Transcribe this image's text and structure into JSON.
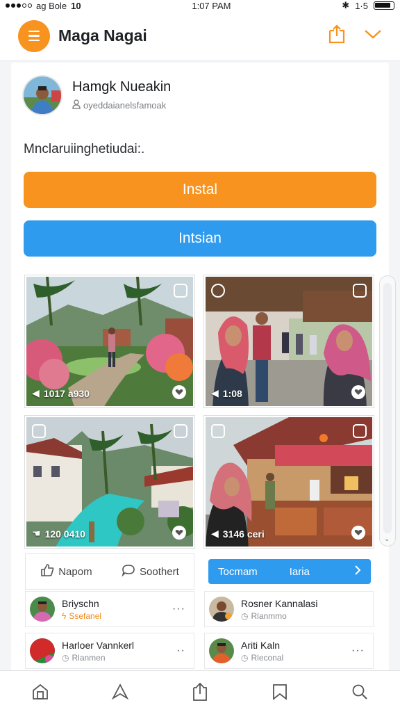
{
  "status": {
    "carrier": "ag Bole",
    "extra": "10",
    "time": "1:07 PAM",
    "battery_text": "1·5"
  },
  "header": {
    "title": "Maga Nagai"
  },
  "profile": {
    "name": "Hamgk Nueakin",
    "handle": "oyeddaianelsfamoak"
  },
  "description": "Mnclaruiinghetiudai:.",
  "buttons": {
    "install": "Instal",
    "secondary": "Intsian"
  },
  "photos": [
    {
      "caption": "1017 a930"
    },
    {
      "caption": "1:08"
    },
    {
      "caption": "120 0410"
    },
    {
      "caption": "3146 ceri"
    }
  ],
  "actions": {
    "like": "Napom",
    "comment": "Soothert"
  },
  "blue_bar": {
    "label1": "Tocmam",
    "label2": "Iaria"
  },
  "users": [
    {
      "name": "Briyschn",
      "sub": "Ssefanel",
      "more": "···",
      "orange": true
    },
    {
      "name": "Rosner Kannalasi",
      "sub": "Rlanmmo",
      "more": "",
      "orange": false
    },
    {
      "name": "Harloer Vannkerl",
      "sub": "Rlanmen",
      "more": "··",
      "orange": false
    },
    {
      "name": "Ariti Kaln",
      "sub": "Rleconal",
      "more": "···",
      "orange": false
    }
  ],
  "icons": {
    "menu": "menu-icon",
    "share": "share-icon",
    "chevron": "chevron-down-icon",
    "home": "home-icon",
    "send": "send-icon",
    "upload": "upload-icon",
    "bookmark": "bookmark-icon",
    "search": "search-icon"
  },
  "colors": {
    "accent": "#f7931e",
    "blue": "#2e9bef"
  }
}
